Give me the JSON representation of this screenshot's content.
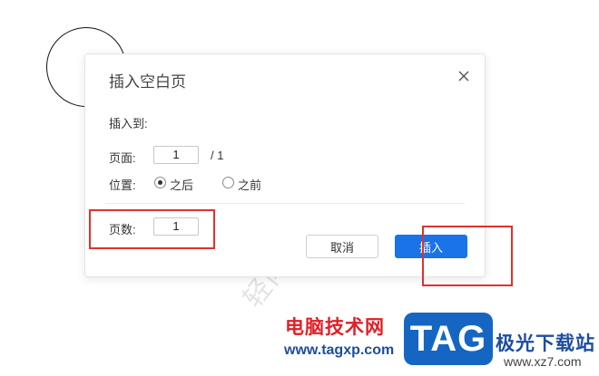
{
  "dialog": {
    "title": "插入空白页",
    "insert_to_label": "插入到:",
    "page_label": "页面:",
    "page_value": "1",
    "page_total": "/ 1",
    "position_label": "位置:",
    "position_options": [
      {
        "label": "之后",
        "checked": true
      },
      {
        "label": "之前",
        "checked": false
      }
    ],
    "count_label": "页数:",
    "count_value": "1",
    "cancel_label": "取消",
    "insert_label": "插入"
  },
  "background": {
    "watermark_text": "轻闪PDF"
  },
  "watermark": {
    "cn_text": "电脑技术网",
    "url": "www.tagxp.com",
    "logo_text": "TAG",
    "site_name": "极光下载站",
    "site_url": "www.xz7.com"
  },
  "colors": {
    "primary": "#1a73e8",
    "highlight": "#e0312f"
  }
}
